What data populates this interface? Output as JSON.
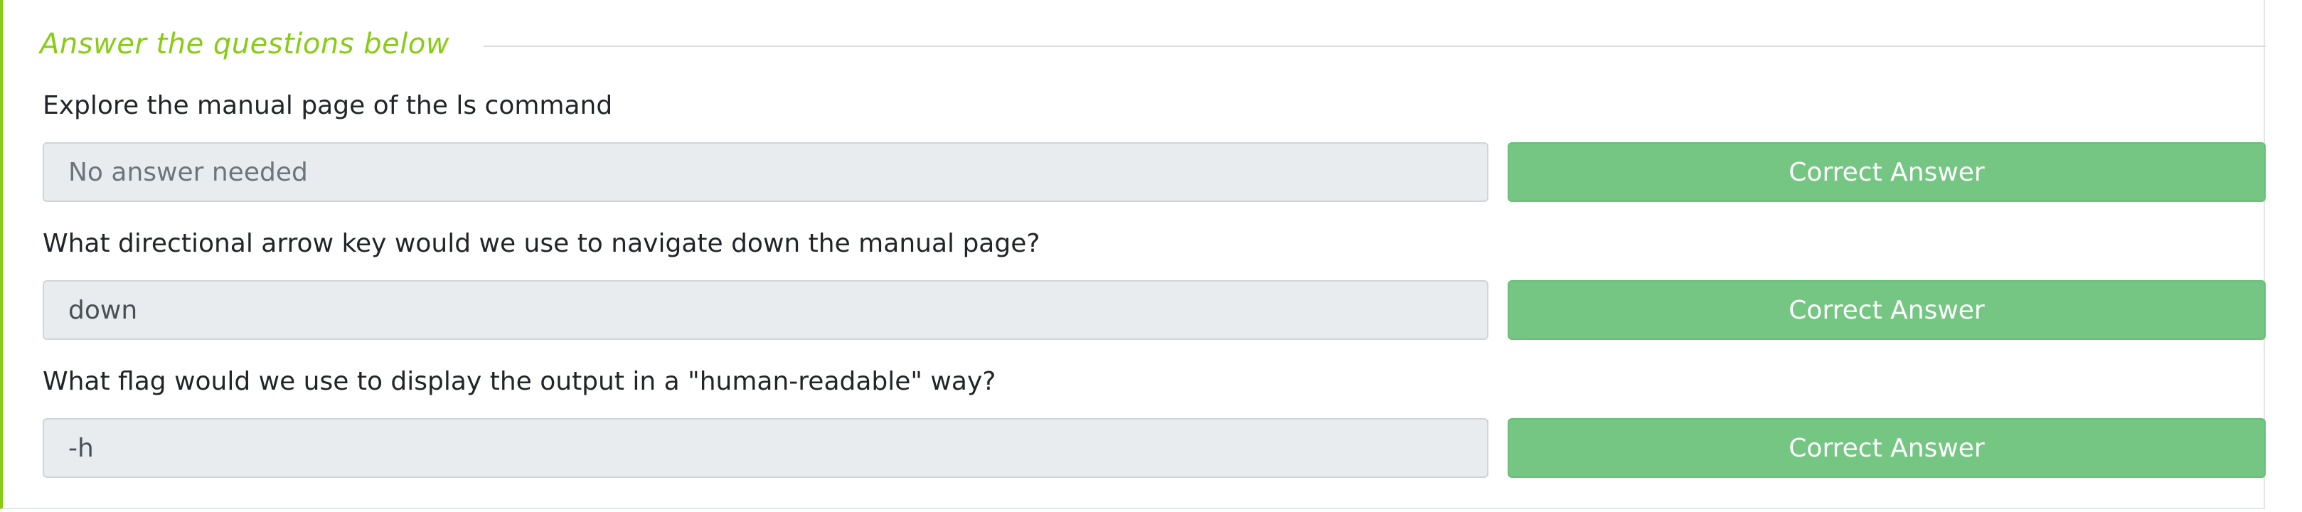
{
  "section": {
    "title": "Answer the questions below"
  },
  "questions": [
    {
      "text": "Explore the manual page of the ls command",
      "answer": "No answer needed",
      "button_label": "Correct Answer"
    },
    {
      "text": "What directional arrow key would we use to navigate down the manual page?",
      "answer": "down",
      "button_label": "Correct Answer"
    },
    {
      "text": "What flag would we use to display the output in a \"human-readable\" way?",
      "answer": "-h",
      "button_label": "Correct Answer"
    }
  ],
  "colors": {
    "accent": "#88cc14",
    "success": "#74c682",
    "input_bg": "#e9ecef"
  }
}
